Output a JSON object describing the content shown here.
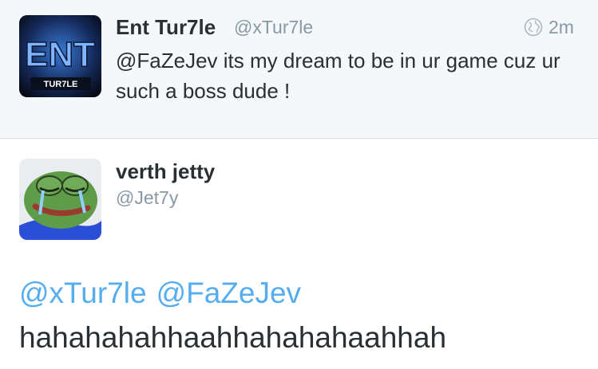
{
  "tweets": [
    {
      "name": "Ent Tur7le",
      "handle": "@xTur7le",
      "time": "2m",
      "text": "@FaZeJev its my dream to be in ur game cuz ur such a boss dude !",
      "avatar_text": "ENT",
      "avatar_subtext": "TUR7LE",
      "globe_icon": "globe-icon"
    },
    {
      "name": "verth jetty",
      "handle": "@Jet7y",
      "mentions": [
        "@xTur7le",
        "@FaZeJev"
      ],
      "text": "hahahahahhaahhahahahaahhah",
      "avatar_icon": "crying-frog-avatar"
    }
  ],
  "colors": {
    "link": "#55acee",
    "text": "#292f33",
    "muted": "#8899a6",
    "highlight_bg": "#f5f8fa"
  }
}
